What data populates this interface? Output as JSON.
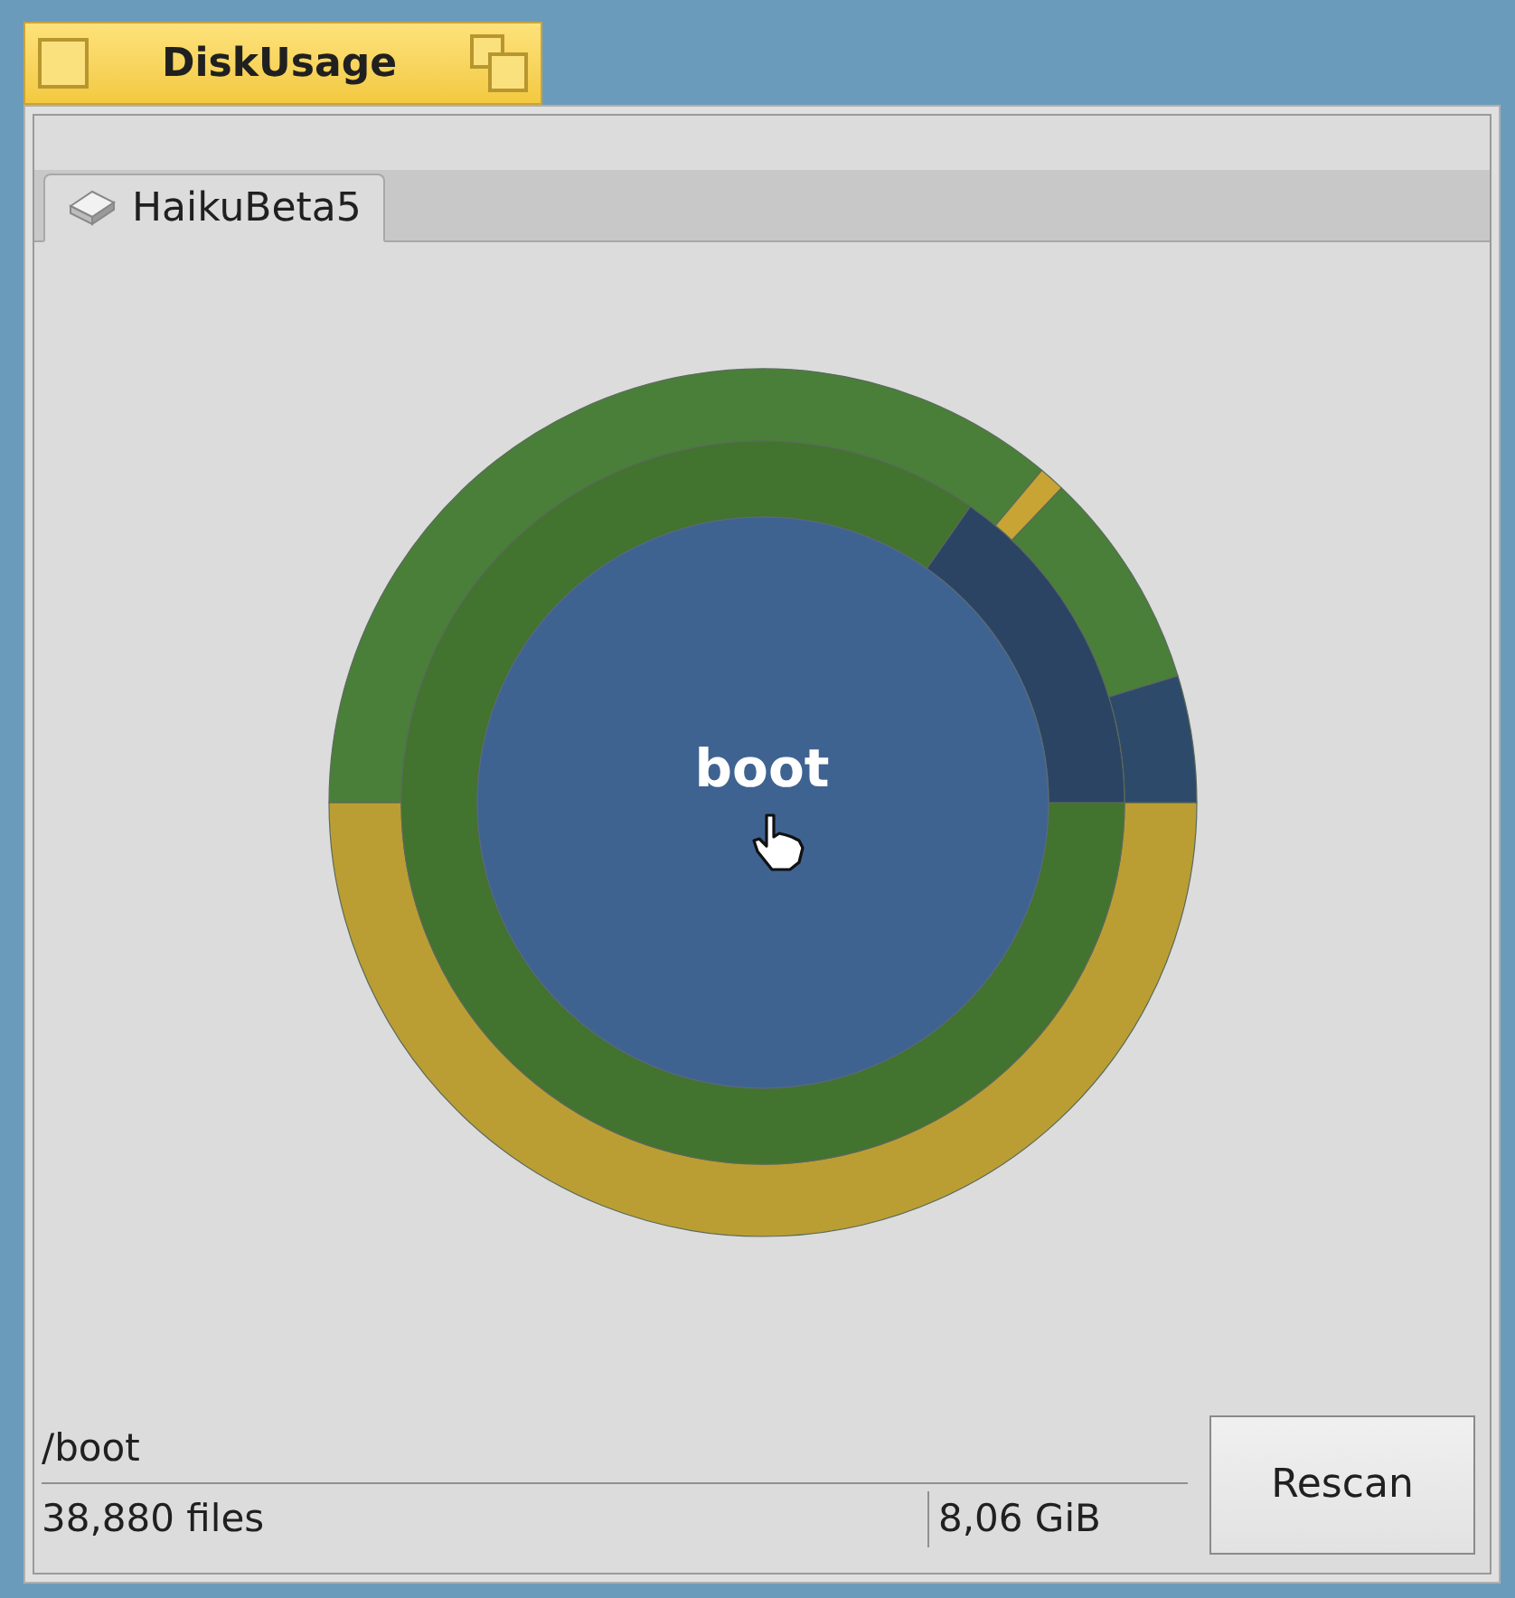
{
  "window": {
    "title": "DiskUsage"
  },
  "tabs": [
    {
      "label": "HaikuBeta5",
      "selected": true
    }
  ],
  "chart": {
    "center_label": "boot"
  },
  "status": {
    "path": "/boot",
    "files": "38,880 files",
    "size": "8,06 GiB"
  },
  "buttons": [
    {
      "label": "Rescan"
    }
  ]
}
